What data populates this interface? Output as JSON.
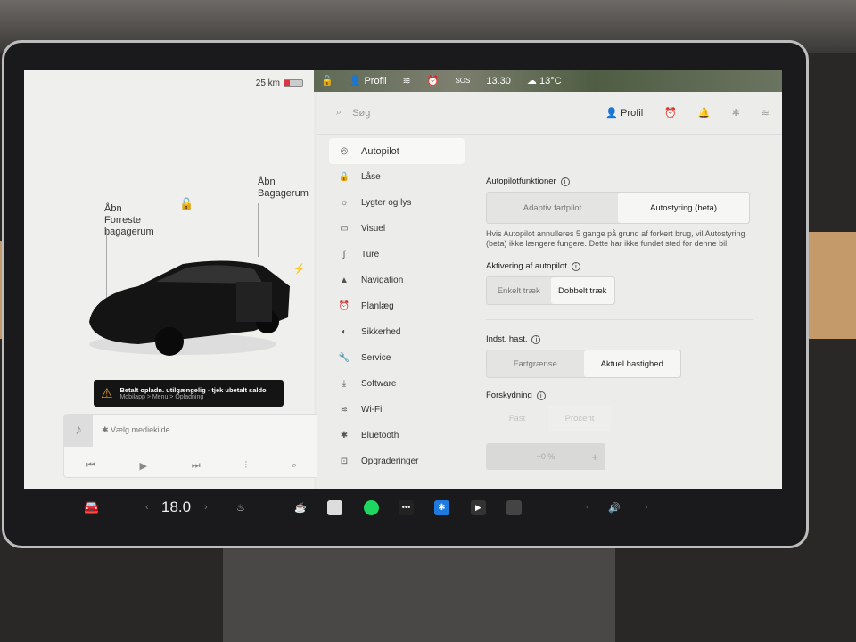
{
  "left": {
    "range": "25 km",
    "frunk_open": "Åbn",
    "frunk_label": "Forreste bagagerum",
    "trunk_open": "Åbn",
    "trunk_label": "Bagagerum",
    "alert": {
      "title": "Betalt opladn. utilgængelig - tjek ubetalt saldo",
      "subtitle": "Mobilapp > Menu > Opladning"
    },
    "media": {
      "source": "Vælg mediekilde"
    }
  },
  "statusbar": {
    "profile": "Profil",
    "time": "13.30",
    "temp": "13°C",
    "sos": "SOS"
  },
  "topbar": {
    "search_placeholder": "Søg",
    "profile": "Profil"
  },
  "nav": [
    {
      "label": "Autopilot",
      "icon": "steering-wheel-icon"
    },
    {
      "label": "Låse",
      "icon": "lock-icon"
    },
    {
      "label": "Lygter og lys",
      "icon": "light-icon"
    },
    {
      "label": "Visuel",
      "icon": "display-icon"
    },
    {
      "label": "Ture",
      "icon": "trips-icon"
    },
    {
      "label": "Navigation",
      "icon": "navigation-icon"
    },
    {
      "label": "Planlæg",
      "icon": "clock-icon"
    },
    {
      "label": "Sikkerhed",
      "icon": "safety-icon"
    },
    {
      "label": "Service",
      "icon": "wrench-icon"
    },
    {
      "label": "Software",
      "icon": "download-icon"
    },
    {
      "label": "Wi-Fi",
      "icon": "wifi-icon"
    },
    {
      "label": "Bluetooth",
      "icon": "bluetooth-icon"
    },
    {
      "label": "Opgraderinger",
      "icon": "bag-icon"
    }
  ],
  "selected_nav": "Autopilot",
  "autopilot": {
    "features_title": "Autopilotfunktioner",
    "features_options": [
      "Adaptiv fartpilot",
      "Autostyring (beta)"
    ],
    "features_selected": "Autostyring (beta)",
    "note": "Hvis Autopilot annulleres 5 gange på grund af forkert brug, vil Autostyring (beta) ikke længere fungere. Dette har ikke fundet sted for denne bil.",
    "activation_title": "Aktivering af autopilot",
    "activation_options": [
      "Enkelt træk",
      "Dobbelt træk"
    ],
    "activation_selected": "Dobbelt træk",
    "speed_title": "Indst. hast.",
    "speed_options": [
      "Fartgrænse",
      "Aktuel hastighed"
    ],
    "speed_selected": "Aktuel hastighed",
    "offset_title": "Forskydning",
    "offset_options": [
      "Fast",
      "Procent"
    ],
    "offset_value": "+0 %"
  },
  "taskbar": {
    "temperature": "18.0"
  },
  "colors": {
    "alarm": "#e8892b",
    "spotify": "#1ed760",
    "bluetooth": "#1f7ae0",
    "alert_icon": "#f0a020"
  }
}
